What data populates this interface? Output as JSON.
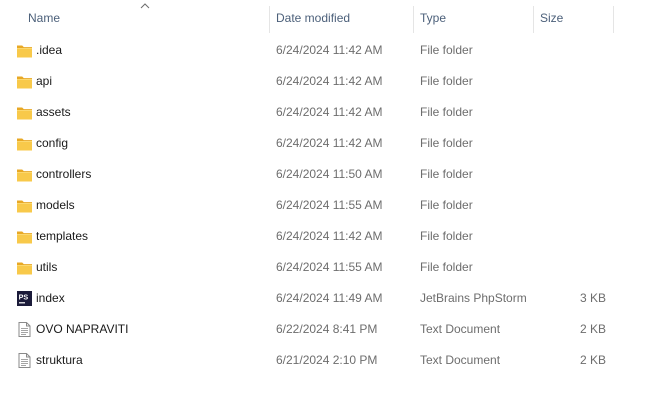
{
  "columns": {
    "name": "Name",
    "date": "Date modified",
    "type": "Type",
    "size": "Size"
  },
  "sort": {
    "column": "name",
    "direction": "ascending"
  },
  "files": [
    {
      "name": ".idea",
      "date": "6/24/2024 11:42 AM",
      "type": "File folder",
      "size": "",
      "icon": "folder-icon"
    },
    {
      "name": "api",
      "date": "6/24/2024 11:42 AM",
      "type": "File folder",
      "size": "",
      "icon": "folder-icon"
    },
    {
      "name": "assets",
      "date": "6/24/2024 11:42 AM",
      "type": "File folder",
      "size": "",
      "icon": "folder-icon"
    },
    {
      "name": "config",
      "date": "6/24/2024 11:42 AM",
      "type": "File folder",
      "size": "",
      "icon": "folder-icon"
    },
    {
      "name": "controllers",
      "date": "6/24/2024 11:50 AM",
      "type": "File folder",
      "size": "",
      "icon": "folder-icon"
    },
    {
      "name": "models",
      "date": "6/24/2024 11:55 AM",
      "type": "File folder",
      "size": "",
      "icon": "folder-icon"
    },
    {
      "name": "templates",
      "date": "6/24/2024 11:42 AM",
      "type": "File folder",
      "size": "",
      "icon": "folder-icon"
    },
    {
      "name": "utils",
      "date": "6/24/2024 11:55 AM",
      "type": "File folder",
      "size": "",
      "icon": "folder-icon"
    },
    {
      "name": "index",
      "date": "6/24/2024 11:49 AM",
      "type": "JetBrains PhpStorm",
      "size": "3 KB",
      "icon": "phpstorm-file-icon"
    },
    {
      "name": "OVO NAPRAVITI",
      "date": "6/22/2024 8:41 PM",
      "type": "Text Document",
      "size": "2 KB",
      "icon": "text-document-icon"
    },
    {
      "name": "struktura",
      "date": "6/21/2024 2:10 PM",
      "type": "Text Document",
      "size": "2 KB",
      "icon": "text-document-icon"
    }
  ],
  "colors": {
    "header_text": "#4c607a",
    "secondary_text": "#6d6d6d",
    "folder": "#f8c94a",
    "folder_dark": "#e8a825",
    "phpstorm_bg": "#1b1b3a"
  }
}
